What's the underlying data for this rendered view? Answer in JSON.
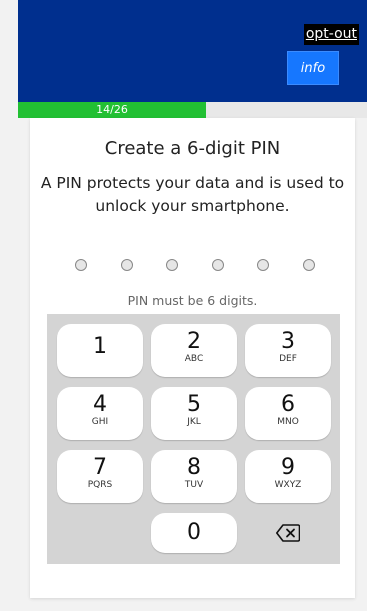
{
  "header": {
    "opt_out": "opt-out",
    "info": "info"
  },
  "progress": {
    "label": "14/26",
    "current": 14,
    "total": 26
  },
  "pin": {
    "title": "Create a 6-digit PIN",
    "description": "A PIN protects your data and is used to unlock your smartphone.",
    "hint": "PIN must be 6 digits.",
    "length": 6,
    "entered": 0
  },
  "keypad": {
    "keys": [
      {
        "digit": "1",
        "letters": ""
      },
      {
        "digit": "2",
        "letters": "ABC"
      },
      {
        "digit": "3",
        "letters": "DEF"
      },
      {
        "digit": "4",
        "letters": "GHI"
      },
      {
        "digit": "5",
        "letters": "JKL"
      },
      {
        "digit": "6",
        "letters": "MNO"
      },
      {
        "digit": "7",
        "letters": "PQRS"
      },
      {
        "digit": "8",
        "letters": "TUV"
      },
      {
        "digit": "9",
        "letters": "WXYZ"
      },
      {
        "digit": "0",
        "letters": ""
      }
    ],
    "backspace_icon": "backspace-icon"
  },
  "colors": {
    "header_bg": "#002f8e",
    "progress_fill": "#22c033",
    "info_button": "#1677ff"
  }
}
